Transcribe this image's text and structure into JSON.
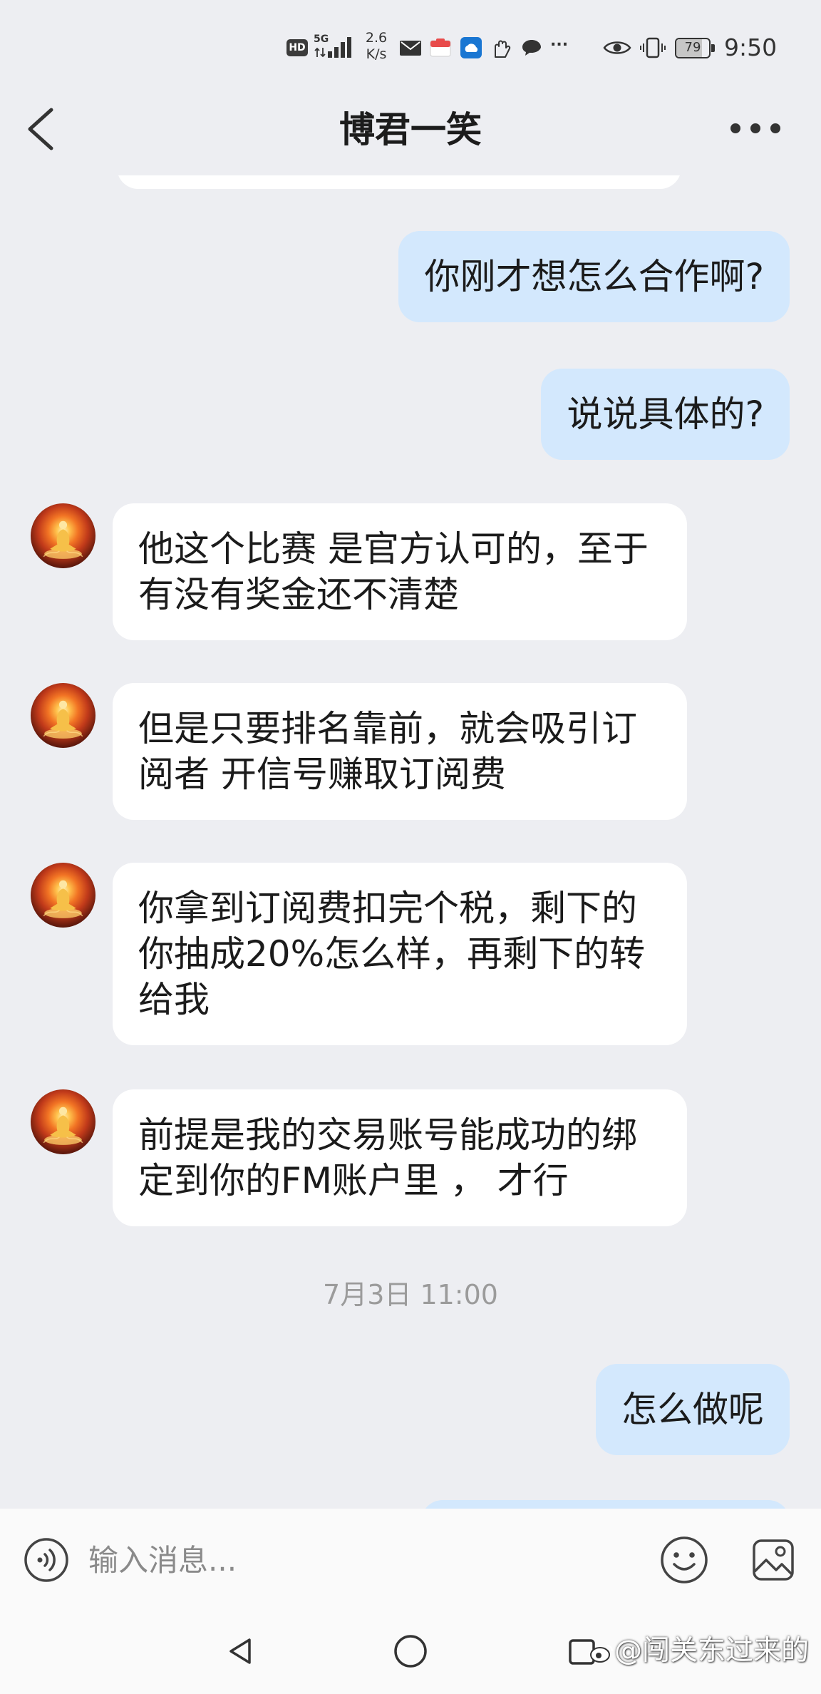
{
  "status_bar": {
    "hd_badge": "HD",
    "network_type": "5G",
    "speed_value": "2.6",
    "speed_unit": "K/s",
    "overflow": "...",
    "battery_percent": "79",
    "time": "9:50",
    "icons": [
      "data-arrows-icon",
      "signal-bars-icon",
      "mail-icon",
      "app-notification-icon",
      "cloud-app-icon",
      "hand-icon",
      "chat-icon",
      "eye-comfort-icon",
      "vibrate-icon",
      "battery-icon"
    ]
  },
  "header": {
    "title": "博君一笑",
    "back_icon": "chevron-left-icon",
    "more_icon": "more-horizontal-icon"
  },
  "conversation": [
    {
      "type": "message",
      "sender": "me",
      "lines": [
        "你刚才想怎么合作啊?"
      ]
    },
    {
      "type": "message",
      "sender": "me",
      "lines": [
        "说说具体的?"
      ]
    },
    {
      "type": "message",
      "sender": "contact",
      "lines": [
        "他这个比赛 是官方认可的，至于",
        "有没有奖金还不清楚"
      ]
    },
    {
      "type": "message",
      "sender": "contact",
      "lines": [
        "但是只要排名靠前，就会吸引订",
        "阅者 开信号赚取订阅费"
      ]
    },
    {
      "type": "message",
      "sender": "contact",
      "lines": [
        "你拿到订阅费扣完个税，剩下的",
        "你抽成20%怎么样，再剩下的转",
        "给我"
      ]
    },
    {
      "type": "message",
      "sender": "contact",
      "lines": [
        "前提是我的交易账号能成功的绑",
        "定到你的FM账户里 ， 才行"
      ]
    },
    {
      "type": "time",
      "text": "7月3日 11:00"
    },
    {
      "type": "message",
      "sender": "me",
      "lines": [
        "怎么做呢"
      ]
    }
  ],
  "input": {
    "placeholder": "输入消息...",
    "voice_icon": "voice-input-icon",
    "emoji_icon": "emoji-icon",
    "image_icon": "image-icon"
  },
  "nav_bar": {
    "icons": [
      "nav-back-icon",
      "nav-home-icon",
      "nav-recents-icon"
    ]
  },
  "watermark": {
    "text": "@闯关东过来的"
  },
  "colors": {
    "background": "#edeef2",
    "bubble_sent": "#d3e8fd",
    "bubble_received": "#ffffff",
    "input_bar": "#fafafa"
  }
}
